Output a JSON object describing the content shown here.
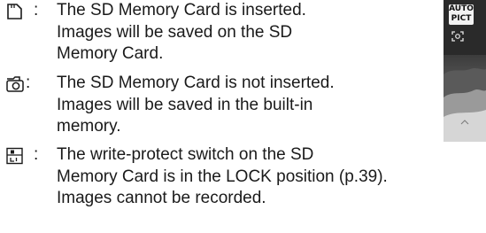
{
  "entries": [
    {
      "icon": "sd-card-icon",
      "lines": [
        "The SD Memory Card is inserted.",
        "Images will be saved on the SD",
        "Memory Card."
      ]
    },
    {
      "icon": "built-in-memory-icon",
      "lines": [
        "The SD Memory Card is not inserted.",
        "Images will be saved in the built-in",
        "memory."
      ]
    },
    {
      "icon": "sd-card-locked-icon",
      "lines": [
        "The write-protect switch on the SD",
        "Memory Card is in the LOCK position (p.39).",
        "Images cannot be recorded."
      ]
    }
  ],
  "colon": ":",
  "camera_display": {
    "mode_badge_line1": "AUTO",
    "mode_badge_line2": "PICT"
  }
}
